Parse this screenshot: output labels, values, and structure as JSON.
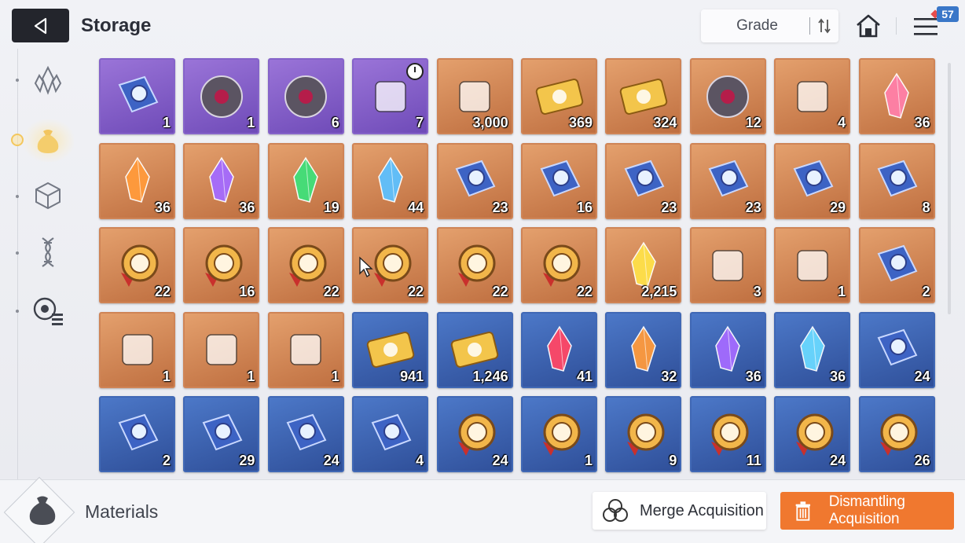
{
  "header": {
    "title": "Storage",
    "sort_label": "Grade",
    "notification_count": "57"
  },
  "sidebar": {
    "items": [
      {
        "name": "crystal-icon",
        "active": false
      },
      {
        "name": "bag-icon",
        "active": true
      },
      {
        "name": "cube-icon",
        "active": false
      },
      {
        "name": "helix-icon",
        "active": false
      },
      {
        "name": "target-list-icon",
        "active": false
      }
    ]
  },
  "items": [
    {
      "grade": "purple",
      "icon": "skill-book-icon",
      "qty": "1"
    },
    {
      "grade": "purple",
      "icon": "dark-orb-icon",
      "qty": "1"
    },
    {
      "grade": "purple",
      "icon": "red-core-icon",
      "qty": "6"
    },
    {
      "grade": "purple",
      "icon": "pyramid-relic-icon",
      "qty": "7",
      "timer": true
    },
    {
      "grade": "orange",
      "icon": "blue-spirit-icon",
      "qty": "3,000"
    },
    {
      "grade": "orange",
      "icon": "gold-ticket-icon",
      "qty": "369"
    },
    {
      "grade": "orange",
      "icon": "star-ticket-icon",
      "qty": "324"
    },
    {
      "grade": "orange",
      "icon": "eye-core-icon",
      "qty": "12"
    },
    {
      "grade": "orange",
      "icon": "gold-feather-icon",
      "qty": "4"
    },
    {
      "grade": "orange",
      "icon": "pink-crystal-icon",
      "qty": "36"
    },
    {
      "grade": "orange",
      "icon": "orange-crystal-icon",
      "qty": "36"
    },
    {
      "grade": "orange",
      "icon": "purple-crystal-icon",
      "qty": "36"
    },
    {
      "grade": "orange",
      "icon": "green-crystal-icon",
      "qty": "19"
    },
    {
      "grade": "orange",
      "icon": "blue-crystal-icon",
      "qty": "44"
    },
    {
      "grade": "orange",
      "icon": "sword-book-icon",
      "qty": "23"
    },
    {
      "grade": "orange",
      "icon": "shield-book-icon",
      "qty": "16"
    },
    {
      "grade": "orange",
      "icon": "eye-book-icon",
      "qty": "23"
    },
    {
      "grade": "orange",
      "icon": "wing-book-icon",
      "qty": "23"
    },
    {
      "grade": "orange",
      "icon": "bolt-book-icon",
      "qty": "29"
    },
    {
      "grade": "orange",
      "icon": "rune-book-icon",
      "qty": "8"
    },
    {
      "grade": "orange",
      "icon": "sword-medal-icon",
      "qty": "22"
    },
    {
      "grade": "orange",
      "icon": "shield-medal-icon",
      "qty": "16"
    },
    {
      "grade": "orange",
      "icon": "eye-medal-icon",
      "qty": "22"
    },
    {
      "grade": "orange",
      "icon": "wing-medal-icon",
      "qty": "22"
    },
    {
      "grade": "orange",
      "icon": "bolt-medal-icon",
      "qty": "22"
    },
    {
      "grade": "orange",
      "icon": "rune-medal-icon",
      "qty": "22"
    },
    {
      "grade": "orange",
      "icon": "gold-shard-icon",
      "qty": "2,215"
    },
    {
      "grade": "orange",
      "icon": "blue-octahedron-icon",
      "qty": "3"
    },
    {
      "grade": "orange",
      "icon": "sneakers-icon",
      "qty": "1"
    },
    {
      "grade": "orange",
      "icon": "star-tome-icon",
      "qty": "2"
    },
    {
      "grade": "orange",
      "icon": "spray-gun-icon",
      "qty": "1"
    },
    {
      "grade": "orange",
      "icon": "sealed-letter-icon",
      "qty": "1"
    },
    {
      "grade": "orange",
      "icon": "dreamcatcher-icon",
      "qty": "1"
    },
    {
      "grade": "blue",
      "icon": "blue-ticket-icon",
      "qty": "941"
    },
    {
      "grade": "blue",
      "icon": "blue-star-ticket-icon",
      "qty": "1,246"
    },
    {
      "grade": "blue",
      "icon": "red-shard-icon",
      "qty": "41"
    },
    {
      "grade": "blue",
      "icon": "orange-shard-icon",
      "qty": "32"
    },
    {
      "grade": "blue",
      "icon": "purple-shard-icon",
      "qty": "36"
    },
    {
      "grade": "blue",
      "icon": "cyan-shard-icon",
      "qty": "36"
    },
    {
      "grade": "blue",
      "icon": "sword-book-icon",
      "qty": "24"
    },
    {
      "grade": "blue",
      "icon": "shield-book-icon",
      "qty": "2"
    },
    {
      "grade": "blue",
      "icon": "wing-book-icon",
      "qty": "29"
    },
    {
      "grade": "blue",
      "icon": "bolt-book-icon",
      "qty": "24"
    },
    {
      "grade": "blue",
      "icon": "rune-book-icon",
      "qty": "4"
    },
    {
      "grade": "blue",
      "icon": "sword-medal-icon",
      "qty": "24"
    },
    {
      "grade": "blue",
      "icon": "shield-medal-icon",
      "qty": "1"
    },
    {
      "grade": "blue",
      "icon": "eye-medal-icon",
      "qty": "9"
    },
    {
      "grade": "blue",
      "icon": "wing-medal-icon",
      "qty": "11"
    },
    {
      "grade": "blue",
      "icon": "bolt-medal-icon",
      "qty": "24"
    },
    {
      "grade": "blue",
      "icon": "rune-medal-icon",
      "qty": "26"
    }
  ],
  "footer": {
    "category_label": "Materials",
    "merge_label": "Merge Acquisition",
    "dismantle_label": "Dismantling Acquisition"
  },
  "colors": {
    "purple_grade": "#7a55c4",
    "orange_grade": "#cf8456",
    "blue_grade": "#3b62ae",
    "accent_orange": "#f0782f"
  }
}
